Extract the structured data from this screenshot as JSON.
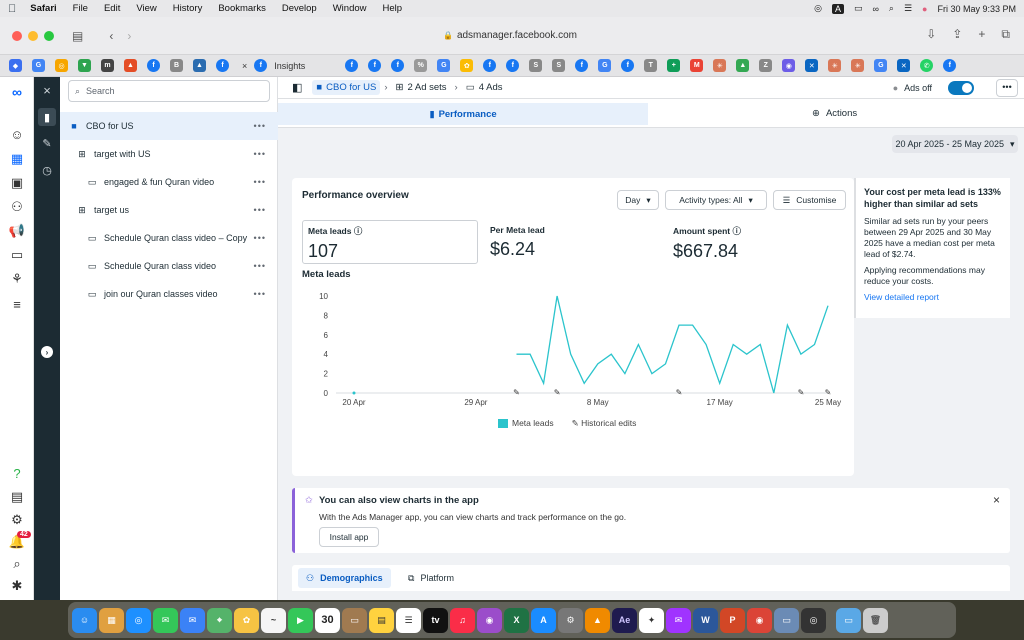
{
  "menubar": {
    "app": "Safari",
    "items": [
      "File",
      "Edit",
      "View",
      "History",
      "Bookmarks",
      "Develop",
      "Window",
      "Help"
    ],
    "clock": "Fri 30 May  9:33 PM",
    "input_source": "A"
  },
  "browser": {
    "url": "adsmanager.facebook.com",
    "active_tab_label": "Insights"
  },
  "tree": {
    "search_placeholder": "Search",
    "items": [
      {
        "label": "CBO for US",
        "kind": "campaign",
        "selected": true
      },
      {
        "label": "target with US",
        "kind": "adset"
      },
      {
        "label": "engaged & fun Quran video",
        "kind": "ad"
      },
      {
        "label": "target us",
        "kind": "adset"
      },
      {
        "label": "Schedule Quran class video – Copy",
        "kind": "ad"
      },
      {
        "label": "Schedule Quran class video",
        "kind": "ad"
      },
      {
        "label": "join our Quran classes video",
        "kind": "ad"
      }
    ],
    "more_label": "•••"
  },
  "breadcrumb": {
    "campaign": "CBO for US",
    "adsets": "2 Ad sets",
    "ads": "4 Ads"
  },
  "header": {
    "ads_off_label": "Ads off",
    "more_label": "•••"
  },
  "tabs": {
    "performance": "Performance",
    "actions": "Actions"
  },
  "date_range": "20 Apr 2025 - 25 May 2025",
  "performance": {
    "title": "Performance overview",
    "granularity": "Day",
    "activity_types": "Activity types: All",
    "customise": "Customise",
    "metrics": [
      {
        "label": "Meta leads",
        "value": "107"
      },
      {
        "label": "Per Meta lead",
        "value": "$6.24"
      },
      {
        "label": "Amount spent",
        "value": "$667.84"
      }
    ],
    "chart_label": "Meta leads",
    "legend": {
      "series": "Meta leads",
      "edits": "Historical edits"
    }
  },
  "chart_data": {
    "type": "line",
    "ylabel": "",
    "ylim": [
      0,
      10
    ],
    "yticks": [
      0,
      2,
      4,
      6,
      8,
      10
    ],
    "xtick_labels": [
      {
        "label": "20 Apr",
        "day": 0
      },
      {
        "label": "29 Apr",
        "day": 9
      },
      {
        "label": "8 May",
        "day": 18
      },
      {
        "label": "17 May",
        "day": 27
      },
      {
        "label": "25 May",
        "day": 35
      }
    ],
    "series": [
      {
        "name": "Meta leads",
        "color": "#2bc4cc",
        "points": [
          [
            12,
            4
          ],
          [
            13,
            4
          ],
          [
            14,
            1
          ],
          [
            15,
            10
          ],
          [
            16,
            4
          ],
          [
            17,
            1
          ],
          [
            18,
            3
          ],
          [
            19,
            4
          ],
          [
            20,
            2
          ],
          [
            21,
            5
          ],
          [
            22,
            2
          ],
          [
            23,
            3
          ],
          [
            24,
            7
          ],
          [
            25,
            7
          ],
          [
            26,
            5
          ],
          [
            27,
            1
          ],
          [
            28,
            5
          ],
          [
            29,
            4
          ],
          [
            30,
            5
          ],
          [
            31,
            0
          ],
          [
            32,
            7
          ],
          [
            33,
            4
          ],
          [
            34,
            5
          ],
          [
            35,
            9
          ]
        ]
      }
    ],
    "historical_edit_days": [
      12,
      15,
      24,
      33,
      35
    ]
  },
  "side_note": {
    "heading": "Your cost per meta lead is 133% higher than similar ad sets",
    "body": "Similar ad sets run by your peers between 29 Apr 2025 and 30 May 2025 have a median cost per meta lead of $2.74.",
    "body2": "Applying recommendations may reduce your costs.",
    "link": "View detailed report"
  },
  "promo": {
    "title": "You can also view charts in the app",
    "text": "With the Ads Manager app, you can view charts and track performance on the go.",
    "button": "Install app"
  },
  "bottom_tabs": {
    "demographics": "Demographics",
    "platform": "Platform"
  },
  "rail": {
    "notification_count": "42"
  },
  "dock": {
    "calendar_day": "30"
  },
  "colors": {
    "accent": "#1877f2",
    "series": "#2bc4cc",
    "sidebar_dark": "#1c2b33"
  }
}
